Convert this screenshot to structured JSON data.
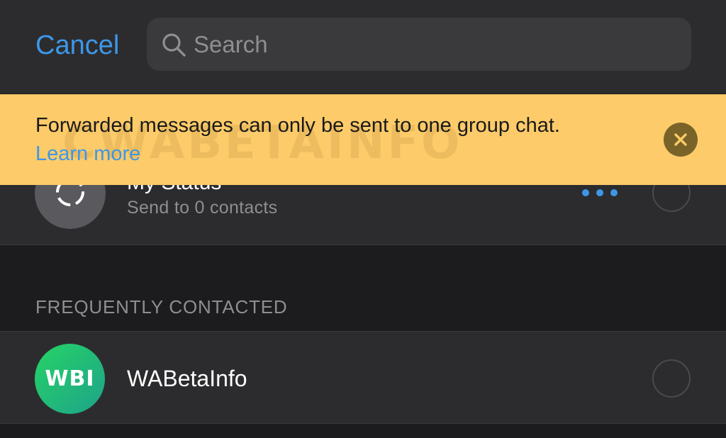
{
  "header": {
    "cancel_label": "Cancel",
    "search_placeholder": "Search"
  },
  "banner": {
    "message": "Forwarded messages can only be sent to one group chat.",
    "link_label": "Learn more",
    "watermark": "CWABETAINFO"
  },
  "status": {
    "title": "My Status",
    "subtitle": "Send to 0 contacts"
  },
  "sections": {
    "frequent_header": "FREQUENTLY CONTACTED"
  },
  "contacts": [
    {
      "name": "WABetaInfo",
      "avatar_initials": "WBI"
    }
  ],
  "colors": {
    "accent": "#3d97e8",
    "banner": "#fdcb69",
    "background": "#1c1c1e",
    "surface": "#2c2c2e"
  },
  "icons": [
    "search-icon",
    "status-ring-icon",
    "more-dots-icon",
    "close-icon"
  ]
}
